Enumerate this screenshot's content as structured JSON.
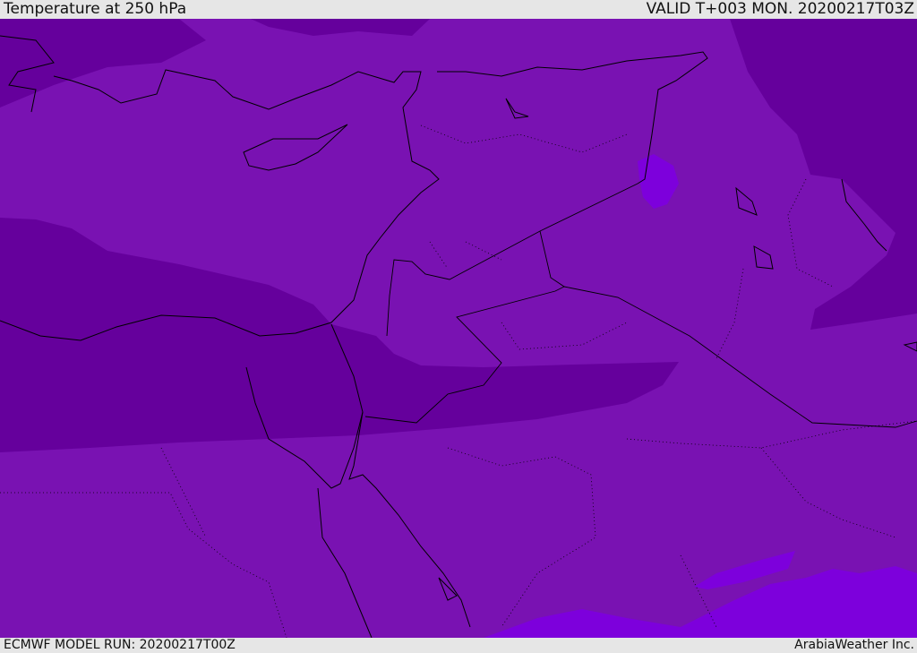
{
  "header": {
    "title": "Temperature at 250 hPa",
    "valid": "VALID T+003 MON. 20200217T03Z"
  },
  "footer": {
    "model_run": "ECMWF MODEL RUN: 20200217T00Z",
    "credit": "ArabiaWeather Inc."
  },
  "colors": {
    "base": "#7912b2",
    "dark": "#65009c",
    "bright": "#7d00dc",
    "coast": "#000000"
  }
}
